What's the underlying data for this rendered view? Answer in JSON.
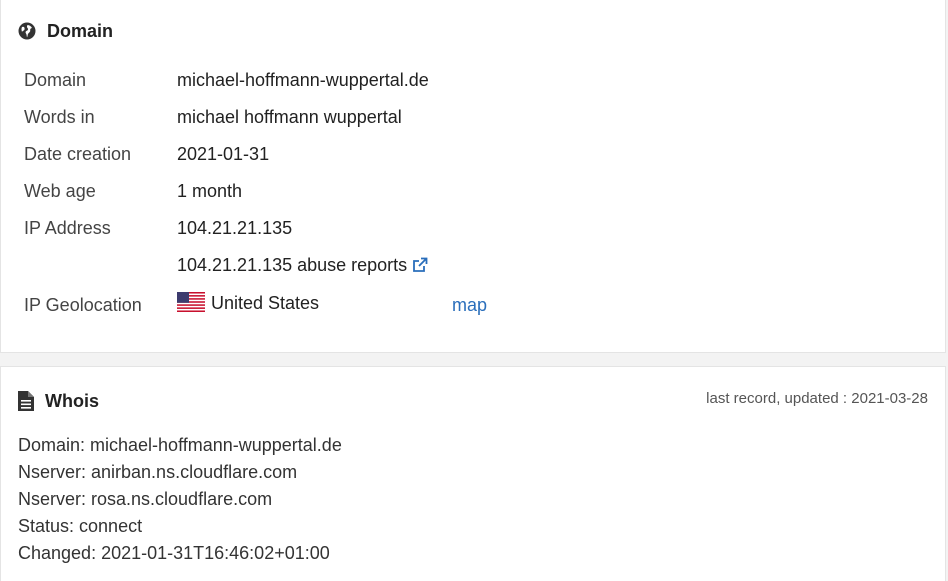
{
  "domain_section": {
    "title": "Domain",
    "icon": "globe-icon",
    "rows": [
      {
        "label": "Domain",
        "value": "michael-hoffmann-wuppertal.de"
      },
      {
        "label": "Words in",
        "value": "michael hoffmann wuppertal"
      },
      {
        "label": "Date creation",
        "value": "2021-01-31"
      },
      {
        "label": "Web age",
        "value": "1 month"
      },
      {
        "label": "IP Address",
        "value": "104.21.21.135"
      }
    ],
    "abuse_link": "104.21.21.135 abuse reports",
    "geolocation": {
      "label": "IP Geolocation",
      "country": "United States",
      "map_link": "map"
    }
  },
  "whois_section": {
    "title": "Whois",
    "icon": "document-icon",
    "updated": "last record, updated : 2021-03-28",
    "lines": [
      "Domain: michael-hoffmann-wuppertal.de",
      "Nserver: anirban.ns.cloudflare.com",
      "Nserver: rosa.ns.cloudflare.com",
      "Status: connect",
      "Changed: 2021-01-31T16:46:02+01:00"
    ]
  },
  "colors": {
    "link": "#2a6ebb",
    "text": "#333333",
    "panel_border": "#e4e4e4"
  }
}
